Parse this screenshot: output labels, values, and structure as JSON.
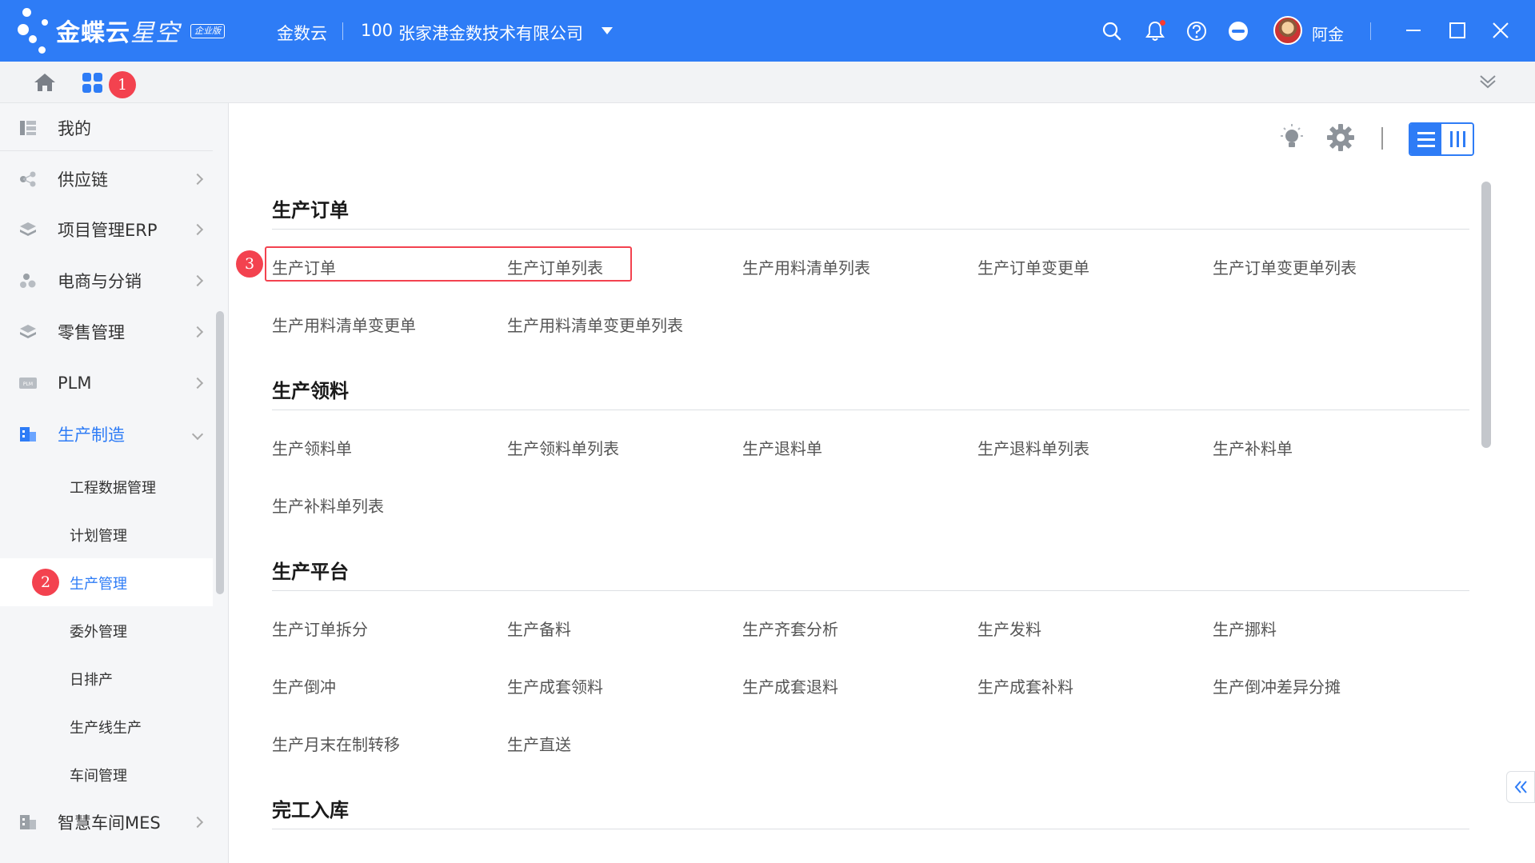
{
  "titlebar": {
    "brand": "金蝶云",
    "brand_light": "星空",
    "edition": "企业版",
    "product": "金数云",
    "company_code": "100",
    "company_name": "张家港金数技术有限公司",
    "username": "阿金",
    "icons": [
      "search-icon",
      "bell-icon",
      "help-icon",
      "more-icon",
      "minimize-icon",
      "maximize-icon",
      "close-icon"
    ]
  },
  "tabbar": {
    "marker_apps": "1"
  },
  "sidebar": {
    "items": [
      {
        "label": "我的",
        "icon": "dashboard-icon"
      },
      {
        "label": "供应链",
        "icon": "share-icon"
      },
      {
        "label": "项目管理ERP",
        "icon": "layers-icon"
      },
      {
        "label": "电商与分销",
        "icon": "cluster-icon"
      },
      {
        "label": "零售管理",
        "icon": "layers-icon"
      },
      {
        "label": "PLM",
        "icon": "plm-icon"
      },
      {
        "label": "生产制造",
        "icon": "factory-icon"
      }
    ],
    "sub_items": [
      "工程数据管理",
      "计划管理",
      "生产管理",
      "委外管理",
      "日排产",
      "生产线生产",
      "车间管理"
    ],
    "marker_selected": "2",
    "bottom_item": {
      "label": "智慧车间MES",
      "icon": "factory-icon"
    }
  },
  "main": {
    "marker_link": "3",
    "sections": [
      {
        "title": "生产订单",
        "links": [
          "生产订单",
          "生产订单列表",
          "生产用料清单列表",
          "生产订单变更单",
          "生产订单变更单列表",
          "生产用料清单变更单",
          "生产用料清单变更单列表"
        ]
      },
      {
        "title": "生产领料",
        "links": [
          "生产领料单",
          "生产领料单列表",
          "生产退料单",
          "生产退料单列表",
          "生产补料单",
          "生产补料单列表"
        ]
      },
      {
        "title": "生产平台",
        "links": [
          "生产订单拆分",
          "生产备料",
          "生产齐套分析",
          "生产发料",
          "生产挪料",
          "生产倒冲",
          "生产成套领料",
          "生产成套退料",
          "生产成套补料",
          "生产倒冲差异分摊",
          "生产月末在制转移",
          "生产直送"
        ]
      },
      {
        "title": "完工入库",
        "links": []
      }
    ]
  },
  "colors": {
    "accent": "#2e7cf6",
    "marker": "#f3424f",
    "sidebar_bg": "#f5f6f8"
  }
}
